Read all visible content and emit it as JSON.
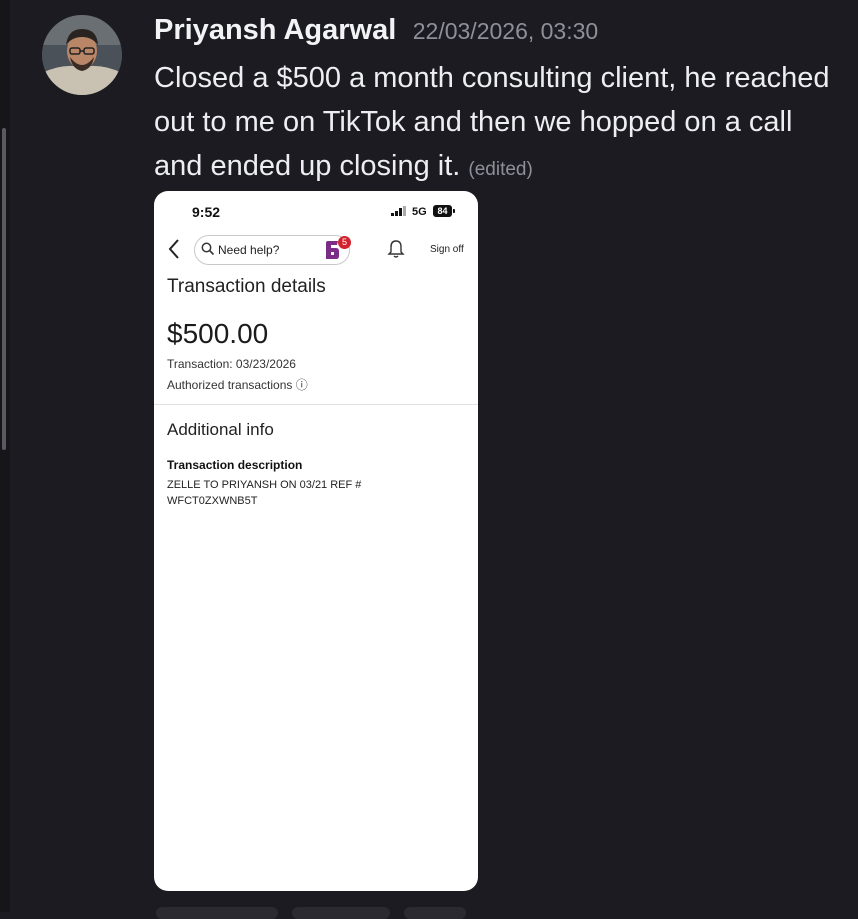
{
  "message": {
    "author": "Priyansh Agarwal",
    "timestamp": "22/03/2026, 03:30",
    "text": "Closed a $500 a month consulting client, he reached out to me on TikTok and then we hopped on a call and ended up closing it.",
    "edited_label": "(edited)"
  },
  "phone": {
    "status": {
      "time": "9:52",
      "network": "5G",
      "battery": "84"
    },
    "nav": {
      "search_placeholder": "Need help?",
      "badge_count": "5",
      "sign_off": "Sign off"
    },
    "details": {
      "title": "Transaction details",
      "amount": "$500.00",
      "transaction_date": "Transaction: 03/23/2026",
      "authorized": "Authorized transactions ⓘ",
      "additional_info": "Additional info",
      "description_label": "Transaction description",
      "description_value": "ZELLE TO PRIYANSH ON 03/21 REF # WFCT0ZXWNB5T"
    }
  },
  "colors": {
    "background": "#1c1b21",
    "author": "#f2f3f5",
    "muted": "#8e9099",
    "badge": "#d2222d",
    "fargo_purple": "#7b2c86"
  },
  "icons": [
    "avatar",
    "back-chevron-icon",
    "search-icon",
    "bank-logo-icon",
    "bell-icon",
    "signal-icon"
  ]
}
